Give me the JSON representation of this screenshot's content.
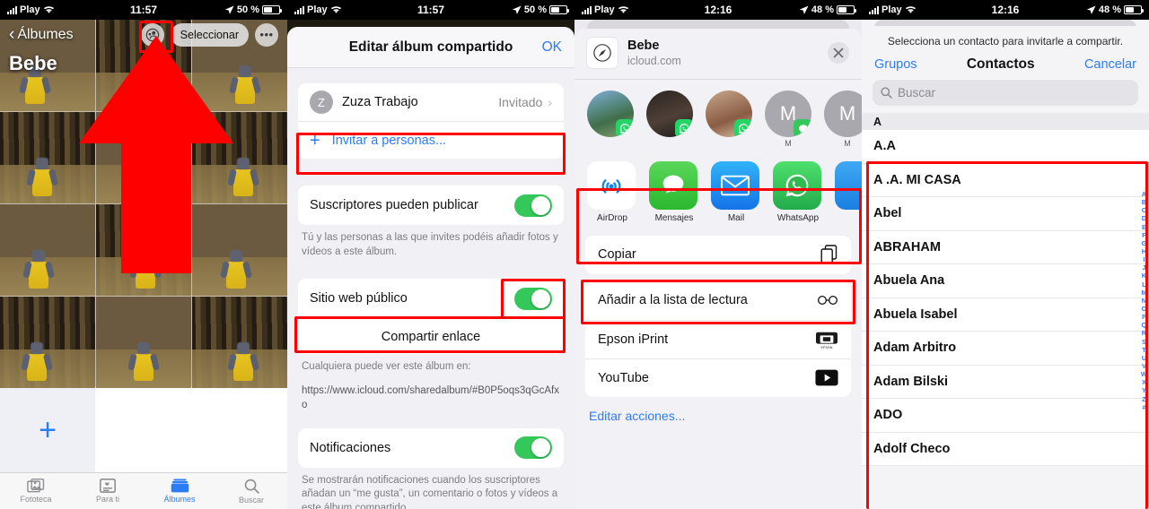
{
  "statusbars": {
    "carrier": "Play",
    "s1": {
      "time": "11:57",
      "battery": "50 %"
    },
    "s2": {
      "time": "11:57",
      "battery": "50 %"
    },
    "s3": {
      "time": "12:16",
      "battery": "48 %"
    },
    "s4": {
      "time": "12:16",
      "battery": "48 %"
    }
  },
  "photos": {
    "back_label": "Álbumes",
    "album_title": "Bebe",
    "select_label": "Seleccionar",
    "more_label": "•••",
    "people_icon": "shared-album-icon",
    "add_label": "+",
    "tabs": [
      {
        "label": "Fototeca",
        "icon": "photos-icon",
        "active": false
      },
      {
        "label": "Para ti",
        "icon": "for-you-icon",
        "active": false
      },
      {
        "label": "Álbumes",
        "icon": "albums-icon",
        "active": true
      },
      {
        "label": "Buscar",
        "icon": "search-icon",
        "active": false
      }
    ]
  },
  "edit_album": {
    "title": "Editar álbum compartido",
    "ok_label": "OK",
    "subscriber": {
      "initial": "Z",
      "name": "Zuza Trabajo",
      "status": "Invitado",
      "chevron": "›"
    },
    "invite_label": "Invitar a personas...",
    "invite_plus": "+",
    "post_toggle_label": "Suscriptores pueden publicar",
    "post_caption": "Tú y las personas a las que invites podéis añadir fotos y vídeos a este álbum.",
    "public_site_label": "Sitio web público",
    "share_link_label": "Compartir enlace",
    "anyone_caption": "Cualquiera puede ver este álbum en:",
    "album_url": "https://www.icloud.com/sharedalbum/#B0P5oqs3qGcAfxo",
    "notifications_label": "Notificaciones",
    "notifications_caption": "Se mostrarán notificaciones cuando los suscriptores añadan un “me gusta”, un comentario o fotos y vídeos a este álbum compartido."
  },
  "share_sheet": {
    "doc_title": "Bebe",
    "doc_subtitle": "icloud.com",
    "app_icon": "safari-compass-icon",
    "close_icon": "close-icon",
    "people": [
      {
        "label": "",
        "badge": "whatsapp-icon",
        "initial": ""
      },
      {
        "label": "",
        "badge": "whatsapp-icon",
        "initial": ""
      },
      {
        "label": "",
        "badge": "whatsapp-icon",
        "initial": ""
      },
      {
        "label": "M",
        "badge": "messages-icon",
        "initial": "M"
      },
      {
        "label": "M",
        "badge": "",
        "initial": "M"
      }
    ],
    "apps": [
      {
        "label": "AirDrop",
        "icon": "airdrop-icon"
      },
      {
        "label": "Mensajes",
        "icon": "messages-icon"
      },
      {
        "label": "Mail",
        "icon": "mail-icon"
      },
      {
        "label": "WhatsApp",
        "icon": "whatsapp-icon"
      },
      {
        "label": "",
        "icon": "blue-app-icon"
      }
    ],
    "actions": [
      {
        "label": "Copiar",
        "icon": "copy-icon"
      },
      {
        "label": "Añadir a la lista de lectura",
        "icon": "glasses-icon"
      },
      {
        "label": "Epson iPrint",
        "icon": "printer-icon"
      },
      {
        "label": "YouTube",
        "icon": "youtube-icon"
      }
    ],
    "edit_actions_label": "Editar acciones..."
  },
  "contacts": {
    "hint": "Selecciona un contacto para invitarle a compartir.",
    "groups_label": "Grupos",
    "title": "Contactos",
    "cancel_label": "Cancelar",
    "search_placeholder": "Buscar",
    "section": "A",
    "items": [
      "A.A",
      "A .A. MI CASA",
      "Abel",
      "ABRAHAM",
      "Abuela Ana",
      "Abuela Isabel",
      "Adam Arbitro",
      "Adam Bilski",
      "ADO",
      "Adolf Checo"
    ],
    "index": [
      "A",
      "B",
      "C",
      "D",
      "E",
      "F",
      "G",
      "H",
      "I",
      "J",
      "K",
      "L",
      "M",
      "N",
      "O",
      "P",
      "Q",
      "R",
      "S",
      "T",
      "U",
      "V",
      "W",
      "X",
      "Y",
      "Z",
      "#"
    ]
  },
  "colors": {
    "accent_blue": "#2c7cf6",
    "toggle_green": "#34c759",
    "highlight_red": "#ff0000",
    "whatsapp_green": "#25d366"
  }
}
